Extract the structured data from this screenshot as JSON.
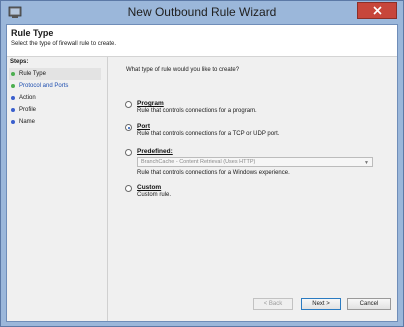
{
  "window": {
    "title": "New Outbound Rule Wizard"
  },
  "header": {
    "title": "Rule Type",
    "description": "Select the type of firewall rule to create."
  },
  "steps": {
    "label": "Steps:",
    "items": [
      {
        "label": "Rule Type",
        "state": "current",
        "dot_color": "#4caf50"
      },
      {
        "label": "Protocol and Ports",
        "state": "next",
        "dot_color": "#4caf50"
      },
      {
        "label": "Action",
        "state": "pending",
        "dot_color": "#3a5fcd"
      },
      {
        "label": "Profile",
        "state": "pending",
        "dot_color": "#3a5fcd"
      },
      {
        "label": "Name",
        "state": "pending",
        "dot_color": "#3a5fcd"
      }
    ]
  },
  "main": {
    "question": "What type of rule would you like to create?",
    "options": [
      {
        "label": "Program",
        "desc": "Rule that controls connections for a program.",
        "selected": false
      },
      {
        "label": "Port",
        "desc": "Rule that controls connections for a TCP or UDP port.",
        "selected": true
      },
      {
        "label": "Predefined:",
        "desc": "Rule that controls connections for a Windows experience.",
        "selected": false,
        "select_value": "BranchCache - Content Retrieval (Uses HTTP)"
      },
      {
        "label": "Custom",
        "desc": "Custom rule.",
        "selected": false
      }
    ]
  },
  "buttons": {
    "back": "< Back",
    "next": "Next >",
    "cancel": "Cancel"
  }
}
